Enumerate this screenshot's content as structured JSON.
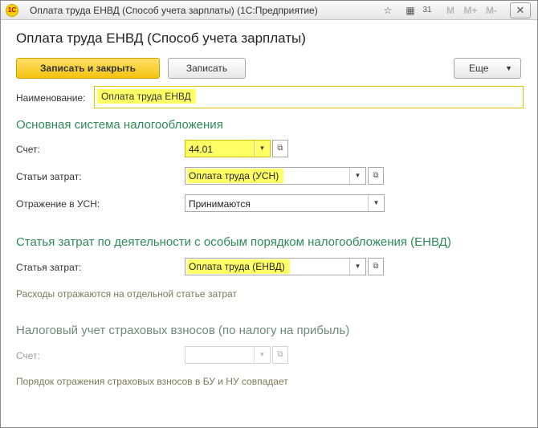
{
  "window": {
    "title": "Оплата труда ЕНВД (Способ учета зарплаты)  (1С:Предприятие)",
    "logo_text": "1С",
    "toolbar_icons": [
      "favorites-icon",
      "calculator-icon",
      "calendar-icon"
    ],
    "toolbar_letters": [
      "M",
      "M+",
      "M-"
    ],
    "calendar_glyph": "31",
    "calculator_glyph": "▦",
    "favorites_glyph": "☆",
    "close_glyph": "✕"
  },
  "form": {
    "title": "Оплата труда ЕНВД (Способ учета зарплаты)"
  },
  "toolbar": {
    "save_close_label": "Записать и закрыть",
    "save_label": "Записать",
    "more_label": "Еще",
    "more_arrow": "▼"
  },
  "name": {
    "label": "Наименование:",
    "value": "Оплата труда ЕНВД"
  },
  "main_tax": {
    "heading": "Основная система налогообложения",
    "account_label": "Счет:",
    "account_value": "44.01",
    "cost_item_label": "Статьи затрат:",
    "cost_item_value": "Оплата труда (УСН)",
    "usn_label": "Отражение в УСН:",
    "usn_value": "Принимаются"
  },
  "envd": {
    "heading": "Статья затрат по деятельности с особым порядком налогообложения (ЕНВД)",
    "cost_item_label": "Статья затрат:",
    "cost_item_value": "Оплата труда (ЕНВД)",
    "note": "Расходы отражаются на отдельной статье затрат"
  },
  "insurance": {
    "heading": "Налоговый учет страховых взносов (по налогу на прибыль)",
    "account_label": "Счет:",
    "account_value": "",
    "note": "Порядок отражения страховых взносов в БУ и НУ совпадает"
  },
  "glyphs": {
    "dropdown": "▼",
    "open": "⧉"
  },
  "colors": {
    "accent_green": "#2e8b57",
    "highlight_yellow": "#ffff66",
    "primary_button": "#f4c20f"
  }
}
